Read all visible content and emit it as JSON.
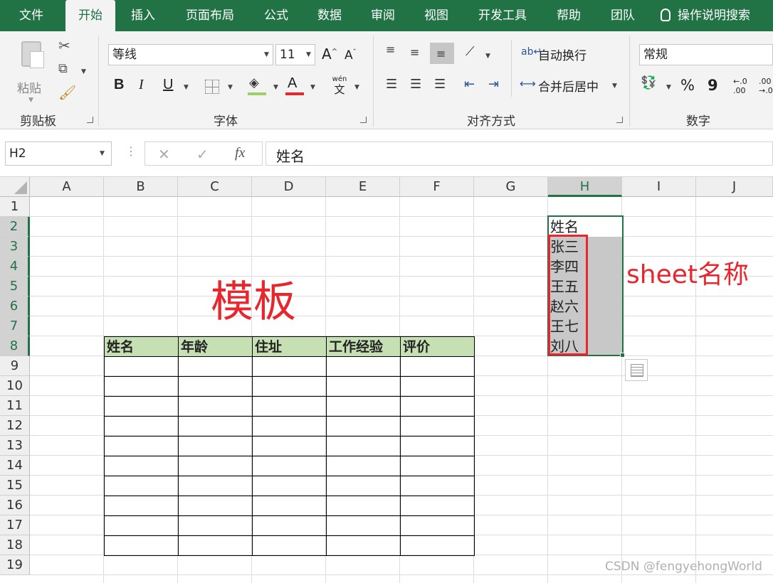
{
  "tabs": [
    "文件",
    "开始",
    "插入",
    "页面布局",
    "公式",
    "数据",
    "审阅",
    "视图",
    "开发工具",
    "帮助",
    "团队",
    "操作说明搜索"
  ],
  "ribbon": {
    "clipboard": {
      "paste": "粘贴",
      "group": "剪贴板"
    },
    "font": {
      "name": "等线",
      "size": "11",
      "group": "字体",
      "bold": "B",
      "italic": "I",
      "underline": "U",
      "grow": "A",
      "shrink": "A",
      "phonetic_top": "wén",
      "phonetic_bottom": "文",
      "font_color": "A"
    },
    "alignment": {
      "wrap": "自动换行",
      "merge": "合并后居中",
      "group": "对齐方式"
    },
    "number": {
      "format": "常规",
      "group": "数字",
      "percent": "%",
      "comma": "9",
      "inc_decimal": ".00",
      "dec_decimal": ".00"
    }
  },
  "formula_bar": {
    "name_box": "H2",
    "cancel": "✕",
    "enter": "✓",
    "fx": "fx",
    "content": "姓名"
  },
  "grid": {
    "columns": [
      "A",
      "B",
      "C",
      "D",
      "E",
      "F",
      "G",
      "H",
      "I",
      "J"
    ],
    "rows": [
      "1",
      "2",
      "3",
      "4",
      "5",
      "6",
      "7",
      "8",
      "9",
      "10",
      "11",
      "12",
      "13",
      "14",
      "15",
      "16",
      "17",
      "18",
      "19"
    ],
    "selected_column": "H",
    "selected_rows": [
      "2",
      "3",
      "4",
      "5",
      "6",
      "7",
      "8"
    ]
  },
  "table": {
    "headers": [
      "姓名",
      "年龄",
      "住址",
      "工作经验",
      "评价"
    ]
  },
  "names": {
    "header": "姓名",
    "items": [
      "张三",
      "李四",
      "王五",
      "赵六",
      "王七",
      "刘八"
    ]
  },
  "annotations": {
    "template": "模板",
    "sheet_name": "sheet名称",
    "watermark": "CSDN @fengyehongWorld"
  },
  "colors": {
    "excel_green": "#217346",
    "header_fill": "#c6e0b4",
    "annotation_red": "#e8262d",
    "selection_fill": "#c8c8c8"
  }
}
